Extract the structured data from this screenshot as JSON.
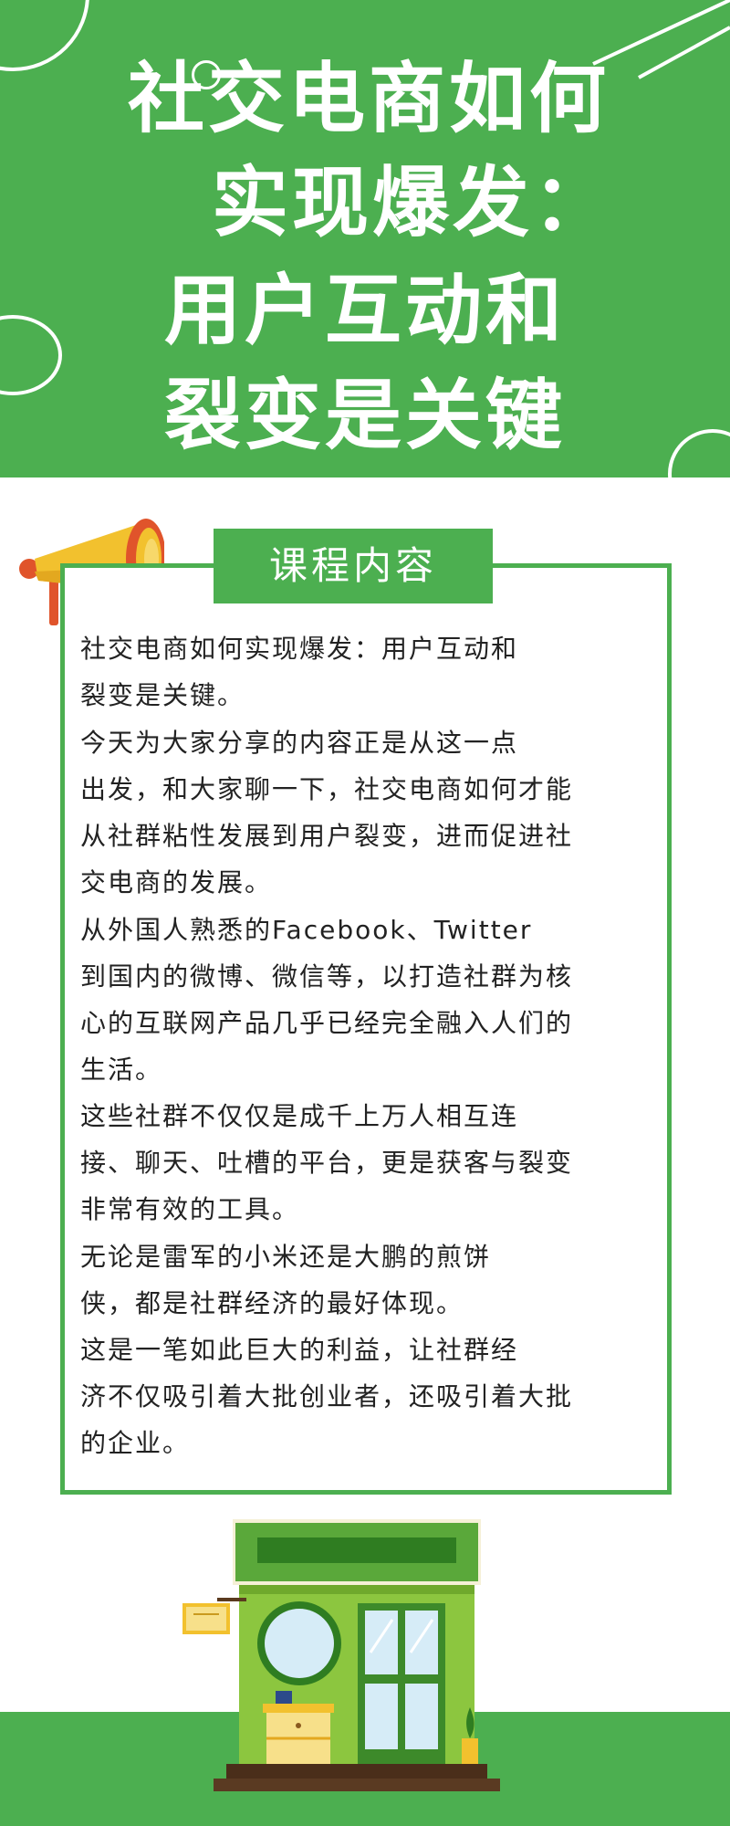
{
  "header": {
    "title_lines": [
      "社交电商如何",
      "实现爆发：",
      "用户互动和",
      "裂变是关键"
    ]
  },
  "card": {
    "title": "课程内容",
    "paragraphs": [
      "      社交电商如何实现爆发：用户互动和\n裂变是关键。",
      "      今天为大家分享的内容正是从这一点\n出发，和大家聊一下，社交电商如何才能\n从社群粘性发展到用户裂变，进而促进社\n交电商的发展。",
      "      从外国人熟悉的Facebook、Twitter\n到国内的微博、微信等，以打造社群为核\n心的互联网产品几乎已经完全融入人们的\n生活。",
      "       这些社群不仅仅是成千上万人相互连\n接、聊天、吐槽的平台，更是获客与裂变\n非常有效的工具。",
      "      无论是雷军的小米还是大鹏的煎饼\n侠，都是社群经济的最好体现。",
      "       这是一笔如此巨大的利益，让社群经\n济不仅吸引着大批创业者，还吸引着大批\n的企业。"
    ]
  },
  "icons": {
    "megaphone": "megaphone-icon",
    "shop": "shop-illustration"
  },
  "colors": {
    "brand_green": "#4caf50",
    "text": "#222222"
  }
}
